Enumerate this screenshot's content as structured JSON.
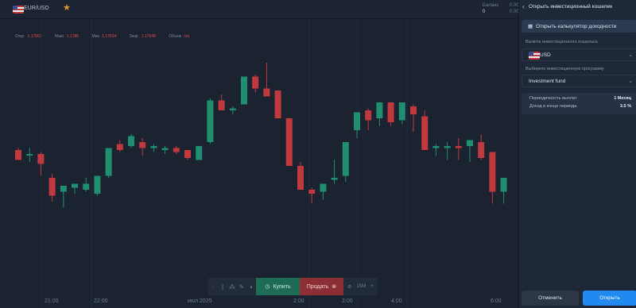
{
  "topbar": {
    "asset": "EUR/USD",
    "balance_label": "Баланс",
    "balance_value": "0",
    "balance2_label": "0.00",
    "balance2_value": "0.00"
  },
  "ohlc": {
    "open_label": "Откр.",
    "open_value": "1.17603",
    "max_label": "Макс",
    "max_value": "1.1785",
    "min_label": "Мин",
    "min_value": "1.17624",
    "close_label": "Закр.",
    "close_value": "1.17648",
    "volume_label": "Объем",
    "volume_value": "n/a"
  },
  "xaxis": {
    "labels": [
      "21:00",
      "22:00",
      "июл 2025",
      "2:00",
      "3:00",
      "4:00",
      "6:00"
    ]
  },
  "toolbar": {
    "buy_label": "Купить",
    "sell_label": "Продать",
    "timeframe": "15M"
  },
  "panel": {
    "title": "Открыть инвестиционный кошелек",
    "calc_label": "Открыть калькулятор доходности",
    "currency_label": "Валюта инвестиционного кошелька",
    "currency_value": "USD",
    "program_label": "Выберите инвестиционную программу",
    "program_value": "Investment fund",
    "payout_label": "Периодичность выплат",
    "payout_value": "1 Месяц",
    "income_label": "Доход в конце периода",
    "income_value": "3.5 %",
    "cancel_label": "Отменить",
    "open_label": "Открыть"
  },
  "colors": {
    "up": "#1f8f6f",
    "down": "#c0393f",
    "accent": "#2189f0"
  },
  "chart_data": {
    "type": "candlestick",
    "candles": [
      {
        "o": 0.5,
        "h": 0.51,
        "l": 0.46,
        "c": 0.45
      },
      {
        "o": 0.475,
        "h": 0.51,
        "l": 0.44,
        "c": 0.48
      },
      {
        "o": 0.48,
        "h": 0.49,
        "l": 0.37,
        "c": 0.43
      },
      {
        "o": 0.36,
        "h": 0.38,
        "l": 0.24,
        "c": 0.27
      },
      {
        "o": 0.29,
        "h": 0.32,
        "l": 0.21,
        "c": 0.32
      },
      {
        "o": 0.31,
        "h": 0.33,
        "l": 0.28,
        "c": 0.33
      },
      {
        "o": 0.3,
        "h": 0.36,
        "l": 0.29,
        "c": 0.33
      },
      {
        "o": 0.28,
        "h": 0.31,
        "l": 0.27,
        "c": 0.37
      },
      {
        "o": 0.37,
        "h": 0.49,
        "l": 0.36,
        "c": 0.51
      },
      {
        "o": 0.53,
        "h": 0.55,
        "l": 0.49,
        "c": 0.5
      },
      {
        "o": 0.52,
        "h": 0.58,
        "l": 0.51,
        "c": 0.57
      },
      {
        "o": 0.54,
        "h": 0.56,
        "l": 0.47,
        "c": 0.51
      },
      {
        "o": 0.51,
        "h": 0.53,
        "l": 0.49,
        "c": 0.52
      },
      {
        "o": 0.5,
        "h": 0.52,
        "l": 0.48,
        "c": 0.51
      },
      {
        "o": 0.51,
        "h": 0.52,
        "l": 0.48,
        "c": 0.49
      },
      {
        "o": 0.5,
        "h": 0.5,
        "l": 0.45,
        "c": 0.46
      },
      {
        "o": 0.45,
        "h": 0.49,
        "l": 0.45,
        "c": 0.52
      },
      {
        "o": 0.54,
        "h": 0.76,
        "l": 0.53,
        "c": 0.75
      },
      {
        "o": 0.75,
        "h": 0.78,
        "l": 0.7,
        "c": 0.7
      },
      {
        "o": 0.7,
        "h": 0.72,
        "l": 0.68,
        "c": 0.71
      },
      {
        "o": 0.73,
        "h": 0.87,
        "l": 0.73,
        "c": 0.87
      },
      {
        "o": 0.87,
        "h": 0.88,
        "l": 0.79,
        "c": 0.81
      },
      {
        "o": 0.81,
        "h": 0.94,
        "l": 0.77,
        "c": 0.77
      },
      {
        "o": 0.8,
        "h": 0.8,
        "l": 0.7,
        "c": 0.66
      },
      {
        "o": 0.66,
        "h": 0.66,
        "l": 0.43,
        "c": 0.42
      },
      {
        "o": 0.42,
        "h": 0.44,
        "l": 0.4,
        "c": 0.3
      },
      {
        "o": 0.3,
        "h": 0.31,
        "l": 0.23,
        "c": 0.28
      },
      {
        "o": 0.29,
        "h": 0.32,
        "l": 0.25,
        "c": 0.33
      },
      {
        "o": 0.35,
        "h": 0.45,
        "l": 0.33,
        "c": 0.36
      },
      {
        "o": 0.37,
        "h": 0.46,
        "l": 0.34,
        "c": 0.54
      },
      {
        "o": 0.6,
        "h": 0.67,
        "l": 0.56,
        "c": 0.69
      },
      {
        "o": 0.7,
        "h": 0.71,
        "l": 0.6,
        "c": 0.65
      },
      {
        "o": 0.66,
        "h": 0.73,
        "l": 0.62,
        "c": 0.74
      },
      {
        "o": 0.74,
        "h": 0.74,
        "l": 0.62,
        "c": 0.64
      },
      {
        "o": 0.65,
        "h": 0.71,
        "l": 0.63,
        "c": 0.74
      },
      {
        "o": 0.72,
        "h": 0.73,
        "l": 0.59,
        "c": 0.68
      },
      {
        "o": 0.67,
        "h": 0.7,
        "l": 0.55,
        "c": 0.5
      },
      {
        "o": 0.51,
        "h": 0.53,
        "l": 0.47,
        "c": 0.52
      },
      {
        "o": 0.51,
        "h": 0.54,
        "l": 0.45,
        "c": 0.52
      },
      {
        "o": 0.52,
        "h": 0.56,
        "l": 0.45,
        "c": 0.51
      },
      {
        "o": 0.52,
        "h": 0.55,
        "l": 0.44,
        "c": 0.55
      },
      {
        "o": 0.54,
        "h": 0.58,
        "l": 0.45,
        "c": 0.46
      },
      {
        "o": 0.49,
        "h": 0.49,
        "l": 0.23,
        "c": 0.29
      },
      {
        "o": 0.29,
        "h": 0.31,
        "l": 0.23,
        "c": 0.36
      }
    ]
  }
}
